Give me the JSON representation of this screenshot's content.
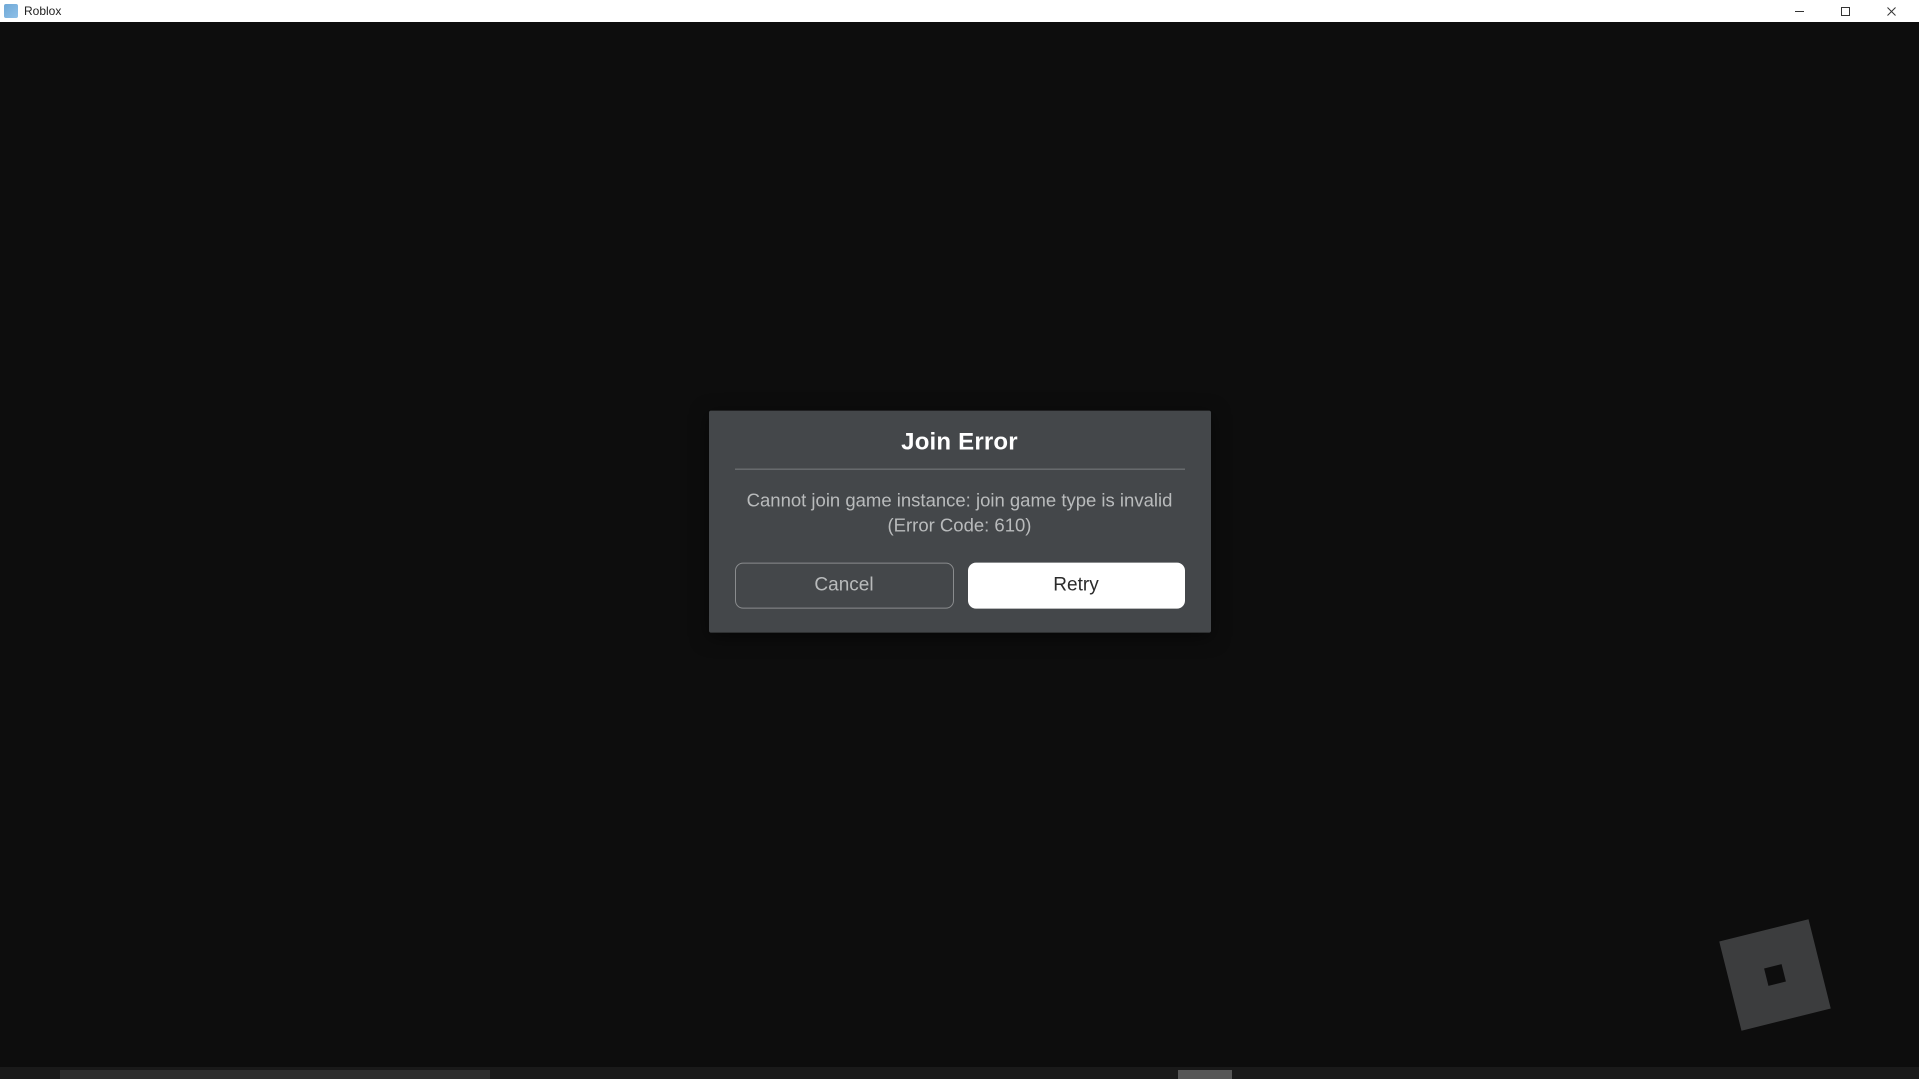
{
  "window": {
    "title": "Roblox"
  },
  "modal": {
    "title": "Join Error",
    "message_line1": "Cannot join game instance: join game type is invalid",
    "message_line2": "(Error Code: 610)",
    "cancel_label": "Cancel",
    "retry_label": "Retry"
  }
}
